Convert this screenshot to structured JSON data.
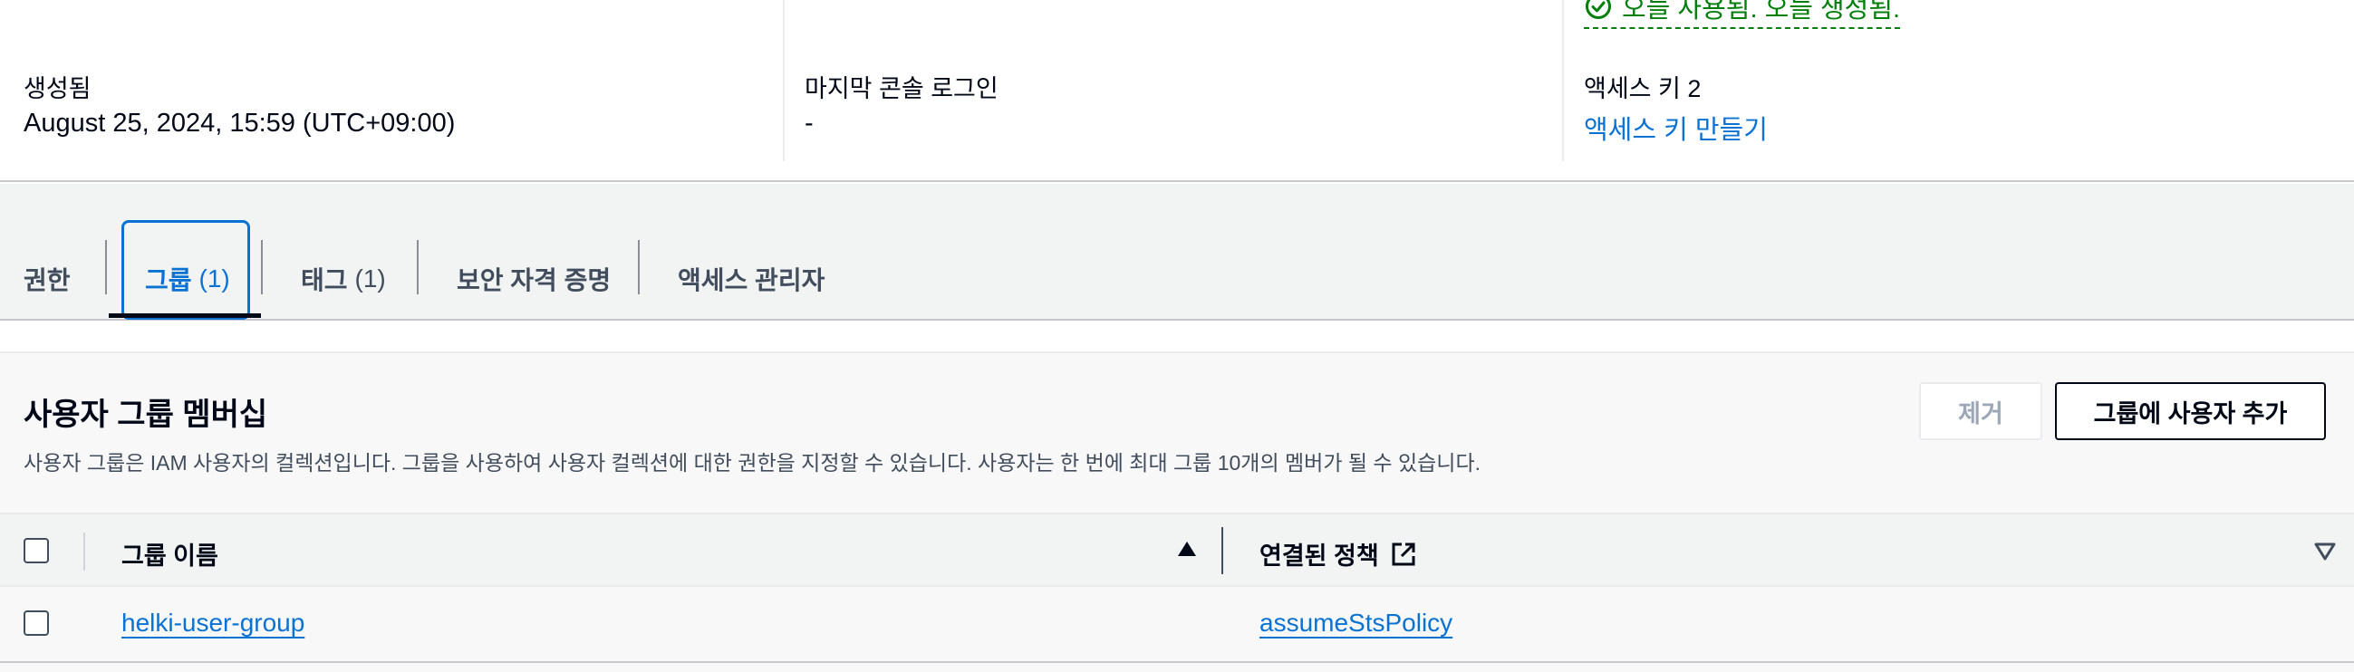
{
  "summary": {
    "created_label": "생성됨",
    "created_value": "August 25, 2024, 15:59 (UTC+09:00)",
    "last_login_label": "마지막 콘솔 로그인",
    "last_login_value": "-",
    "access_key_status": "오늘 사용됨. 오늘 생성됨.",
    "access_key_label": "액세스 키 2",
    "create_access_key_link": "액세스 키 만들기"
  },
  "tabs": [
    {
      "label": "권한",
      "count": ""
    },
    {
      "label": "그룹",
      "count": "(1)"
    },
    {
      "label": "태그",
      "count": "(1)"
    },
    {
      "label": "보안 자격 증명",
      "count": ""
    },
    {
      "label": "액세스 관리자",
      "count": ""
    }
  ],
  "active_tab": "그룹",
  "groups_panel": {
    "title": "사용자 그룹 멤버십",
    "description": "사용자 그룹은 IAM 사용자의 컬렉션입니다. 그룹을 사용하여 사용자 컬렉션에 대한 권한을 지정할 수 있습니다. 사용자는 한 번에 최대 그룹 10개의 멤버가 될 수 있습니다.",
    "remove_button": "제거",
    "add_button": "그룹에 사용자 추가"
  },
  "table": {
    "columns": [
      "그룹 이름",
      "연결된 정책"
    ],
    "rows": [
      {
        "group_name": "helki-user-group",
        "attached_policy": "assumeStsPolicy"
      }
    ]
  },
  "colors": {
    "link": "#0972d3",
    "success": "#037f0c",
    "text": "#000716",
    "band": "#f2f3f3"
  },
  "icons": [
    "status-check-icon",
    "external-link-icon",
    "sort-ascending-icon",
    "column-filter-icon"
  ]
}
